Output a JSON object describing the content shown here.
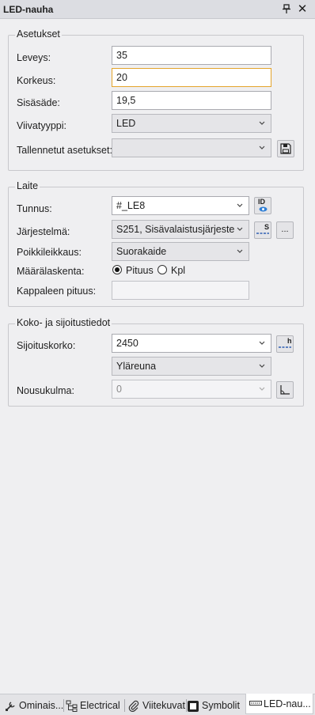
{
  "panel": {
    "title": "LED-nauha"
  },
  "asetukset": {
    "title": "Asetukset",
    "leveys": {
      "label": "Leveys:",
      "value": "35"
    },
    "korkeus": {
      "label": "Korkeus:",
      "value": "20"
    },
    "sisasade": {
      "label": "Sisäsäde:",
      "value": "19,5"
    },
    "viivatyyppi": {
      "label": "Viivatyyppi:",
      "value": "LED"
    },
    "tallennetut": {
      "label": "Tallennetut asetukset:",
      "value": ""
    }
  },
  "laite": {
    "title": "Laite",
    "tunnus": {
      "label": "Tunnus:",
      "value": "#_LE8",
      "id_icon_text": "ID"
    },
    "jarjestelma": {
      "label": "Järjestelmä:",
      "value": "S251, Sisävalaistusjärjestelmä",
      "s_icon_text": "S",
      "more_label": "..."
    },
    "poikkileikkaus": {
      "label": "Poikkileikkaus:",
      "value": "Suorakaide"
    },
    "maaralaskenta": {
      "label": "Määrälaskenta:",
      "option1": "Pituus",
      "option2": "Kpl",
      "selected": "Pituus"
    },
    "kappaleen_pituus": {
      "label": "Kappaleen pituus:",
      "value": ""
    }
  },
  "koko": {
    "title": "Koko- ja sijoitustiedot",
    "sijoituskorko": {
      "label": "Sijoituskorko:",
      "value": "2450",
      "h_icon_text": "h"
    },
    "reference": {
      "value": "Yläreuna"
    },
    "nousukulma": {
      "label": "Nousukulma:",
      "value": "0"
    }
  },
  "tabs": [
    {
      "label": "Ominais...",
      "icon": "properties-icon"
    },
    {
      "label": "Electrical",
      "icon": "electrical-tree-icon"
    },
    {
      "label": "Viitekuvat",
      "icon": "paperclip-icon"
    },
    {
      "label": "Symbolit",
      "icon": "symbol-icon"
    },
    {
      "label": "LED-nau...",
      "icon": "led-strip-icon",
      "active": true
    }
  ]
}
